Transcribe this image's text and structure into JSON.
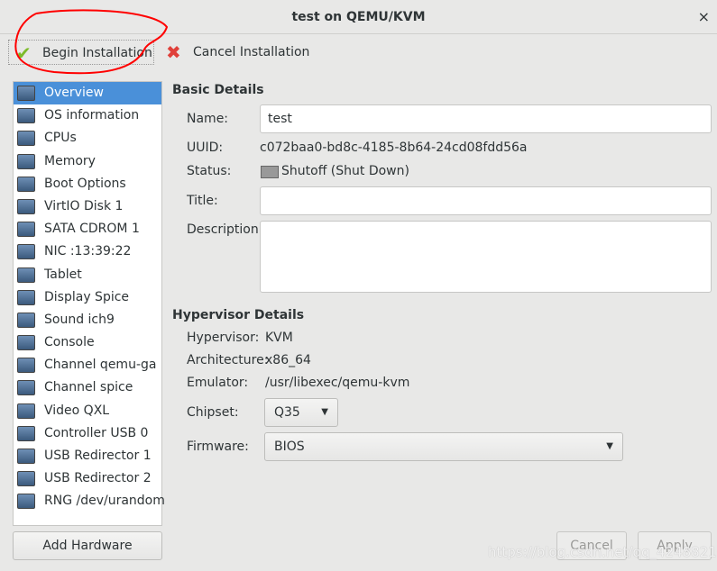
{
  "window": {
    "title": "test on QEMU/KVM",
    "close_glyph": "×"
  },
  "toolbar": {
    "begin": "Begin Installation",
    "cancel": "Cancel Installation"
  },
  "sidebar": {
    "items": [
      {
        "label": "Overview",
        "icon": "monitor-icon"
      },
      {
        "label": "OS information",
        "icon": "monitor-icon"
      },
      {
        "label": "CPUs",
        "icon": "cpu-icon"
      },
      {
        "label": "Memory",
        "icon": "memory-icon"
      },
      {
        "label": "Boot Options",
        "icon": "gears-icon"
      },
      {
        "label": "VirtIO Disk 1",
        "icon": "disk-icon"
      },
      {
        "label": "SATA CDROM 1",
        "icon": "cdrom-icon"
      },
      {
        "label": "NIC :13:39:22",
        "icon": "network-icon"
      },
      {
        "label": "Tablet",
        "icon": "tablet-icon"
      },
      {
        "label": "Display Spice",
        "icon": "monitor-icon"
      },
      {
        "label": "Sound ich9",
        "icon": "sound-card-icon"
      },
      {
        "label": "Console",
        "icon": "serial-icon"
      },
      {
        "label": "Channel qemu-ga",
        "icon": "serial-icon"
      },
      {
        "label": "Channel spice",
        "icon": "serial-icon"
      },
      {
        "label": "Video QXL",
        "icon": "monitor-icon"
      },
      {
        "label": "Controller USB 0",
        "icon": "controller-icon"
      },
      {
        "label": "USB Redirector 1",
        "icon": "usb-icon"
      },
      {
        "label": "USB Redirector 2",
        "icon": "usb-icon"
      },
      {
        "label": "RNG /dev/urandom",
        "icon": "gears-icon"
      }
    ],
    "add": "Add Hardware"
  },
  "basic": {
    "heading": "Basic Details",
    "name_label": "Name:",
    "name": "test",
    "uuid_label": "UUID:",
    "uuid": "c072baa0-bd8c-4185-8b64-24cd08fdd56a",
    "status_label": "Status:",
    "status": "Shutoff (Shut Down)",
    "title_label": "Title:",
    "title": "",
    "desc_label": "Description:",
    "desc": ""
  },
  "hyper": {
    "heading": "Hypervisor Details",
    "hv_label": "Hypervisor:",
    "hv": "KVM",
    "arch_label": "Architecture:",
    "arch": "x86_64",
    "emu_label": "Emulator:",
    "emu": "/usr/libexec/qemu-kvm",
    "chip_label": "Chipset:",
    "chip": "Q35",
    "fw_label": "Firmware:",
    "fw": "BIOS"
  },
  "footer": {
    "cancel": "Cancel",
    "apply": "Apply"
  },
  "watermark": "https://blog.csdn.net/qq_42488216",
  "colors": {
    "selection": "#4a90d9",
    "annotation": "#ff0000"
  }
}
